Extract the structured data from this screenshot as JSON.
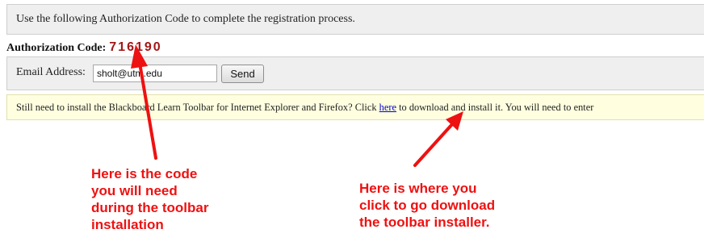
{
  "instruction": {
    "text": "Use the following Authorization Code to complete the registration process."
  },
  "authorization": {
    "label": "Authorization Code:",
    "code": "716190"
  },
  "email": {
    "label": "Email Address:",
    "value": "sholt@utm.edu",
    "send_label": "Send"
  },
  "notice": {
    "before_link": "Still need to install the Blackboard Learn Toolbar for Internet Explorer and Firefox? Click ",
    "link_text": "here",
    "after_link": " to download and install it. You will need to enter"
  },
  "annotations": {
    "left": {
      "lines": [
        "Here is the code",
        "you will need",
        "during the toolbar",
        "installation"
      ]
    },
    "right": {
      "lines": [
        "Here is where you",
        "click to go download",
        "the toolbar installer."
      ]
    },
    "color": "#ee1111"
  },
  "colors": {
    "code_color": "#a31717",
    "link_color": "#0000cc",
    "notice_bg": "#ffffe0",
    "bar_bg": "#efefef"
  }
}
